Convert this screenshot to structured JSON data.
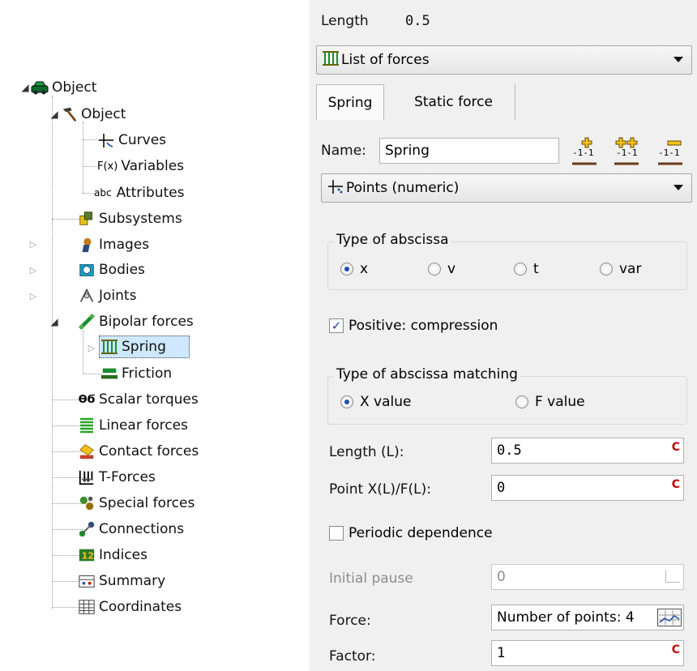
{
  "tree": {
    "root_label": "Object",
    "object_label": "Object",
    "object_children": [
      {
        "label": "Curves",
        "icon": "curves-icon"
      },
      {
        "label": "Variables",
        "icon": "fx-icon",
        "prefix": "F(x)"
      },
      {
        "label": "Attributes",
        "icon": "abc-icon",
        "prefix": "abc"
      }
    ],
    "subsystems_label": "Subsystems",
    "images_label": "Images",
    "bodies_label": "Bodies",
    "joints_label": "Joints",
    "bipolar_label": "Bipolar forces",
    "spring_label": "Spring",
    "friction_label": "Friction",
    "scalar_torques_label": "Scalar torques",
    "linear_forces_label": "Linear forces",
    "contact_forces_label": "Contact forces",
    "t_forces_label": "T-Forces",
    "special_forces_label": "Special forces",
    "connections_label": "Connections",
    "indices_label": "Indices",
    "summary_label": "Summary",
    "coordinates_label": "Coordinates"
  },
  "panel": {
    "length_top_label": "Length",
    "length_top_value": "0.5",
    "list_combo": "List of forces",
    "tabs": [
      "Spring",
      "Static force"
    ],
    "name_label": "Name:",
    "name_value": "Spring",
    "points_combo": "Points (numeric)",
    "abscissa_group": "Type of abscissa",
    "abscissa_options": [
      "x",
      "v",
      "t",
      "var"
    ],
    "abscissa_selected": "x",
    "positive_label": "Positive: compression",
    "positive_checked": true,
    "matching_group": "Type of abscissa matching",
    "matching_options": [
      "X value",
      "F value"
    ],
    "matching_selected": "X value",
    "length_l_label": "Length (L):",
    "length_l_value": "0.5",
    "point_label": "Point X(L)/F(L):",
    "point_value": "0",
    "periodic_label": "Periodic dependence",
    "periodic_checked": false,
    "initial_pause_label": "Initial pause",
    "initial_pause_value": "0",
    "force_label": "Force:",
    "force_value": "Number of points: 4",
    "factor_label": "Factor:",
    "factor_value": "1",
    "c_button": "C"
  },
  "colors": {
    "selection": "#cde8ff",
    "panel_bg": "#f0f0f0",
    "c_red": "#c00000",
    "radio_dot": "#1a4fb0"
  }
}
